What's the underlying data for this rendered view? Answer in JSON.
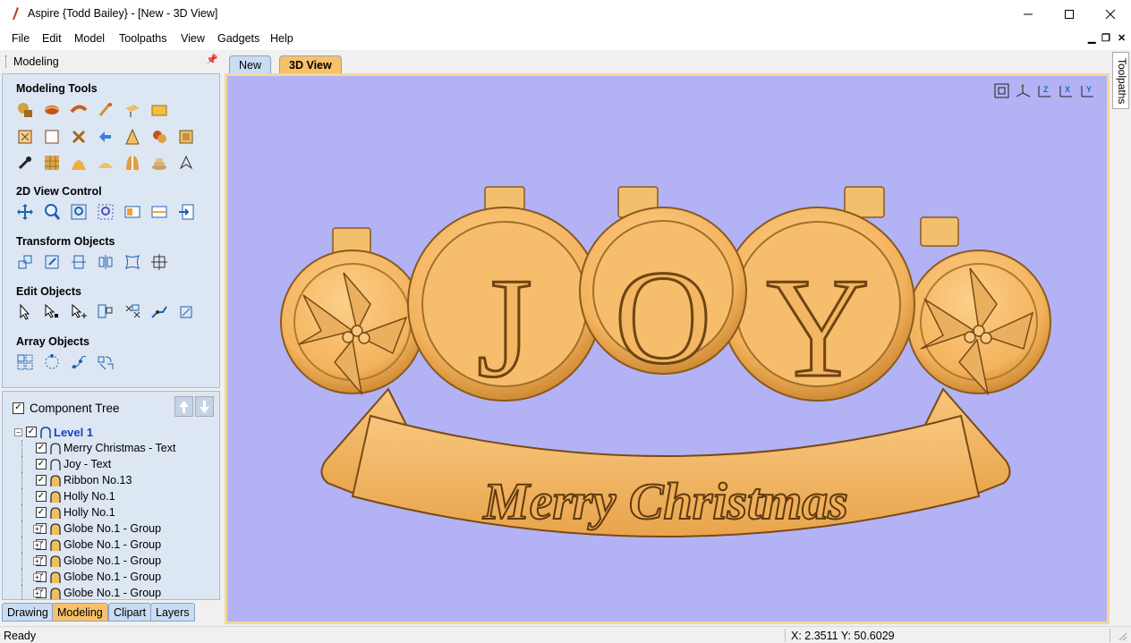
{
  "window": {
    "title": "Aspire {Todd Bailey} - [New - 3D View]"
  },
  "menu": [
    "File",
    "Edit",
    "Model",
    "Toolpaths",
    "View",
    "Gadgets",
    "Help"
  ],
  "left_panel": {
    "header": "Modeling",
    "sections": {
      "modeling_tools": "Modeling Tools",
      "view_control": "2D View Control",
      "transform": "Transform Objects",
      "edit": "Edit Objects",
      "array": "Array Objects"
    }
  },
  "component_tree": {
    "title": "Component Tree",
    "level": "Level 1",
    "items": [
      "Merry Christmas - Text",
      "Joy  - Text",
      "Ribbon No.13",
      "Holly No.1",
      "Holly No.1",
      "Globe No.1 - Group",
      "Globe No.1 - Group",
      "Globe No.1 - Group",
      "Globe No.1 - Group",
      "Globe No.1 - Group"
    ]
  },
  "bottom_tabs": [
    "Drawing",
    "Modeling",
    "Clipart",
    "Layers"
  ],
  "view_tabs": [
    "New",
    "3D View"
  ],
  "right_tab": "Toolpaths",
  "model": {
    "big_letters": [
      "J",
      "O",
      "Y"
    ],
    "banner_text": "Merry Christmas"
  },
  "status": {
    "text": "Ready",
    "coords": "X:  2.3511 Y: 50.6029"
  },
  "colors": {
    "wood": "#f5b55f",
    "view_bg": "#b2b2f5",
    "panel_bg": "#dce7f3",
    "active_tab": "#f7c16a"
  }
}
